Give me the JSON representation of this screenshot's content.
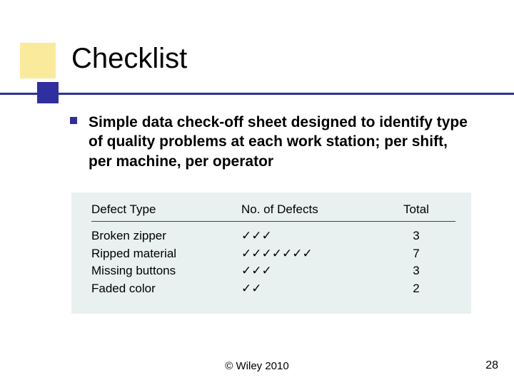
{
  "title": "Checklist",
  "bullet": "Simple data check-off sheet designed to identify type of quality problems at each work station; per shift, per machine, per operator",
  "table": {
    "headers": {
      "type": "Defect Type",
      "tally": "No. of Defects",
      "total": "Total"
    },
    "rows": [
      {
        "type": "Broken zipper",
        "tally": "✓✓✓",
        "total": "3"
      },
      {
        "type": "Ripped material",
        "tally": "✓✓✓✓✓✓✓",
        "total": "7"
      },
      {
        "type": "Missing buttons",
        "tally": "✓✓✓",
        "total": "3"
      },
      {
        "type": "Faded color",
        "tally": "✓✓",
        "total": "2"
      }
    ]
  },
  "footer": "© Wiley 2010",
  "page_number": "28"
}
